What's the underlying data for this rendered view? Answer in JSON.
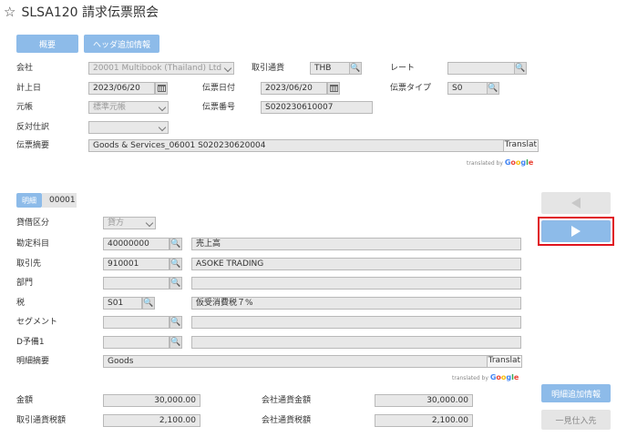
{
  "header": {
    "title": "SLSA120 請求伝票照会"
  },
  "tabs": {
    "overview": "概要",
    "header_extra": "ヘッダ追加情報"
  },
  "form": {
    "company_label": "会社",
    "company_value": "20001 Multibook (Thailand) Ltd",
    "currency_label": "取引通貨",
    "currency_value": "THB",
    "rate_label": "レート",
    "rate_value": "",
    "posting_date_label": "計上日",
    "posting_date_value": "2023/06/20",
    "doc_date_label": "伝票日付",
    "doc_date_value": "2023/06/20",
    "doc_type_label": "伝票タイプ",
    "doc_type_value": "S0",
    "ledger_label": "元帳",
    "ledger_value": "標準元帳",
    "doc_no_label": "伝票番号",
    "doc_no_value": "S020230610007",
    "reverse_label": "反対仕訳",
    "reverse_value": "",
    "summary_label": "伝票摘要",
    "summary_value": "Goods & Services_06001 S020230620004",
    "translate_label": "Translat"
  },
  "google": {
    "translated_by": "translated by",
    "brand": [
      "G",
      "o",
      "o",
      "g",
      "l",
      "e"
    ]
  },
  "detail": {
    "tab_label": "明細",
    "line_no": "00001",
    "dc_label": "貸借区分",
    "dc_value": "貸方",
    "account_label": "勘定科目",
    "account_code": "40000000",
    "account_name": "売上高",
    "customer_label": "取引先",
    "customer_code": "910001",
    "customer_name": "ASOKE TRADING",
    "dept_label": "部門",
    "dept_code": "",
    "dept_name": "",
    "tax_label": "税",
    "tax_code": "S01",
    "tax_name": "仮受消費税７%",
    "segment_label": "セグメント",
    "segment_code": "",
    "segment_name": "",
    "d1_label": "D予備1",
    "d1_code": "",
    "d1_name": "",
    "line_summary_label": "明細摘要",
    "line_summary_value": "Goods"
  },
  "amounts": {
    "amount_label": "金額",
    "amount_value": "30,000.00",
    "company_amount_label": "会社通貨金額",
    "company_amount_value": "30,000.00",
    "tax_label": "取引通貨税額",
    "tax_value": "2,100.00",
    "company_tax_label": "会社通貨税額",
    "company_tax_value": "2,100.00"
  },
  "side": {
    "detail_extra": "明細追加情報",
    "one_time_supplier": "一見仕入先"
  },
  "colors": {
    "accent": "#8dbbe9",
    "highlight": "#e0141e"
  }
}
